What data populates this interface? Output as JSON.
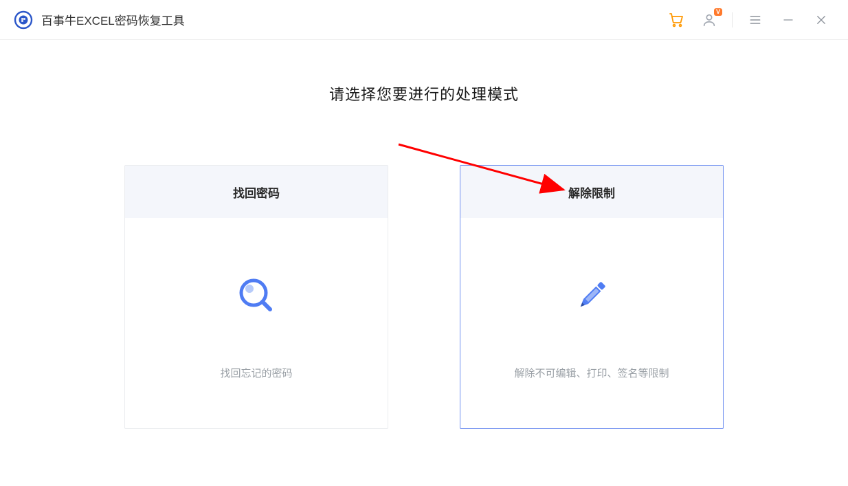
{
  "app": {
    "title": "百事牛EXCEL密码恢复工具"
  },
  "titlebar": {
    "vip_badge": "V"
  },
  "main": {
    "heading": "请选择您要进行的处理模式"
  },
  "cards": {
    "recover": {
      "title": "找回密码",
      "desc": "找回忘记的密码"
    },
    "unlock": {
      "title": "解除限制",
      "desc": "解除不可编辑、打印、签名等限制"
    }
  }
}
